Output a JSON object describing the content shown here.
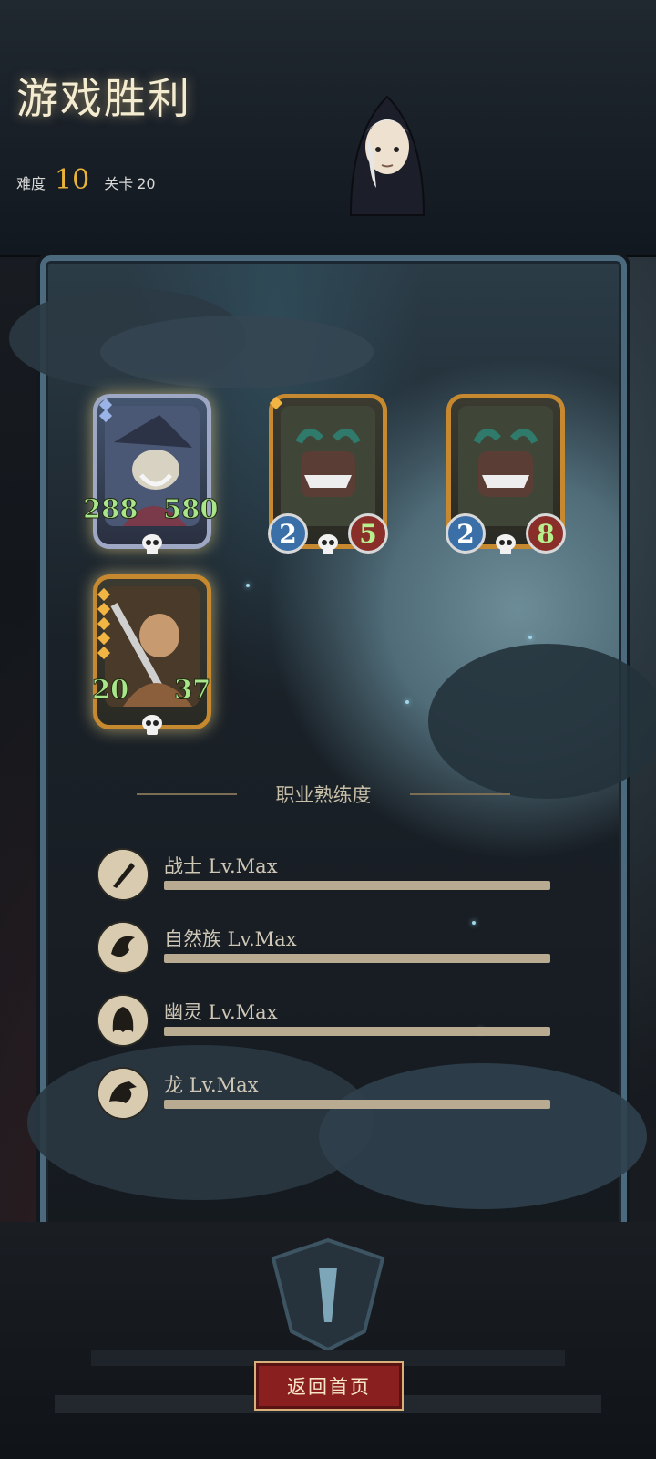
{
  "header": {
    "title": "游戏胜利",
    "difficulty_label": "难度",
    "difficulty_value": "10",
    "stage_label": "关卡",
    "stage_value": "20"
  },
  "cards": [
    {
      "left_stat": "288",
      "right_stat": "580",
      "frame": "silver",
      "subject": "pirate-captain"
    },
    {
      "left_stat": "2",
      "right_stat": "5",
      "frame": "gold",
      "subject": "sea-monster"
    },
    {
      "left_stat": "2",
      "right_stat": "8",
      "frame": "gold",
      "subject": "sea-monster"
    },
    {
      "left_stat": "20",
      "right_stat": "37",
      "frame": "gold",
      "subject": "barbarian"
    }
  ],
  "proficiency": {
    "title": "职业熟练度",
    "items": [
      {
        "label": "战士 Lv.Max",
        "progress": 1.0,
        "icon": "sword-icon"
      },
      {
        "label": "自然族 Lv.Max",
        "progress": 1.0,
        "icon": "nature-icon"
      },
      {
        "label": "幽灵 Lv.Max",
        "progress": 1.0,
        "icon": "ghost-icon"
      },
      {
        "label": "龙 Lv.Max",
        "progress": 1.0,
        "icon": "dragon-icon"
      }
    ]
  },
  "footer": {
    "return_label": "返回首页"
  },
  "colors": {
    "accent_gold": "#e9b23a",
    "stat_green": "#a9e58a",
    "button_red": "#8a1f1f"
  }
}
